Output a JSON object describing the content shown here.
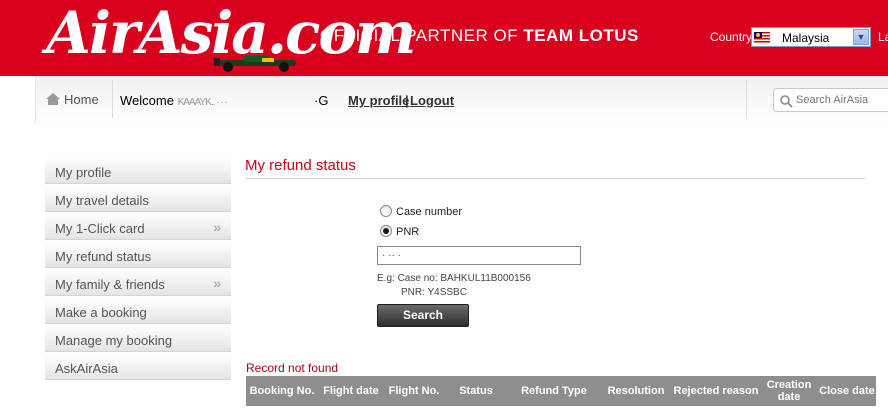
{
  "header": {
    "logo_text": "AirAsia.com",
    "partner_prefix": "OFFICIAL PARTNER OF ",
    "partner_bold": "TEAM LOTUS",
    "country_label": "Country",
    "country_value": "Malaysia",
    "lang_label": "La",
    "brand_color": "#d9001e"
  },
  "nav": {
    "home": "Home",
    "welcome_prefix": "Welcome ",
    "welcome_masked": "KAAAYK..   ·  ·  ·",
    "welcome_suffix": "·G",
    "profile_link": "My profile",
    "separator": "|",
    "logout_link": "Logout",
    "search_placeholder": "Search AirAsia"
  },
  "sidebar": {
    "items": [
      {
        "label": "My profile",
        "chevron": ""
      },
      {
        "label": "My travel details",
        "chevron": ""
      },
      {
        "label": "My 1-Click card",
        "chevron": "»"
      },
      {
        "label": "My refund status",
        "chevron": ""
      },
      {
        "label": "My family & friends",
        "chevron": "»"
      },
      {
        "label": "Make a booking",
        "chevron": ""
      },
      {
        "label": "Manage my booking",
        "chevron": ""
      },
      {
        "label": "AskAirAsia",
        "chevron": ""
      }
    ]
  },
  "main": {
    "title": "My refund status",
    "radio_case": "Case number",
    "radio_pnr": "PNR",
    "selected": "PNR",
    "pnr_value": "· ·· ·",
    "example_line1": "E.g: Case no: BAHKUL11B000156",
    "example_line2": "PNR: Y4SSBC",
    "search_button": "Search",
    "record_message": "Record not found"
  },
  "table": {
    "columns": [
      "Booking No.",
      "Flight date",
      "Flight No.",
      "Status",
      "Refund Type",
      "Resolution",
      "Rejected reason",
      "Creation date",
      "Close date"
    ]
  }
}
